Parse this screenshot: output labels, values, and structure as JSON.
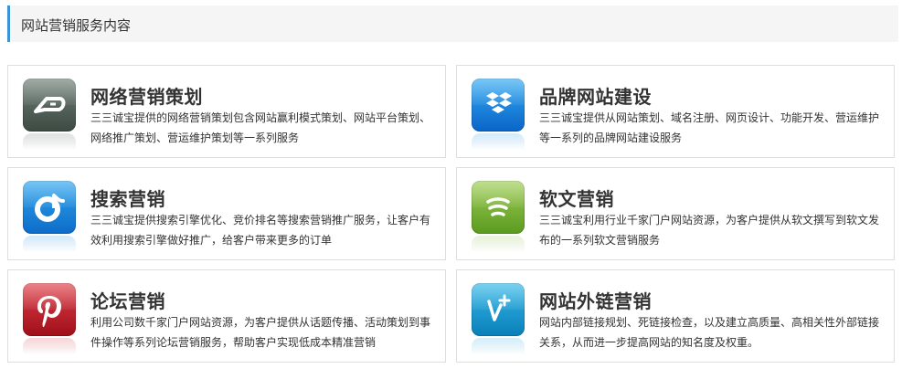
{
  "header": {
    "title": "网站营销服务内容"
  },
  "services": [
    {
      "title": "网络营销策划",
      "icon": "deviantart-icon",
      "color": "#4a5a52",
      "desc": "三三诚宝提供的网络营销策划包含网站赢利模式策划、网站平台策划、网络推广策划、营运维护策划等一系列服务"
    },
    {
      "title": "品牌网站建设",
      "icon": "dropbox-icon",
      "color": "#1a7ad8",
      "desc": "三三诚宝提供从网站策划、域名注册、网页设计、功能开发、营运维护等一系列的品牌网站建设服务"
    },
    {
      "title": "搜索营销",
      "icon": "rdio-icon",
      "color": "#1a86dc",
      "desc": "三三诚宝提供搜索引擎优化、竞价排名等搜索营销推广服务，让客户有效利用搜索引擎做好推广，给客户带来更多的订单"
    },
    {
      "title": "软文营销",
      "icon": "forrst-icon",
      "color": "#7ab43a",
      "desc": "三三诚宝利用行业千家门户网站资源，为客户提供从软文撰写到软文发布的一系列软文营销服务"
    },
    {
      "title": "论坛营销",
      "icon": "pinterest-icon",
      "color": "#c0202a",
      "desc": "利用公司数千家门户网站资源，为客户提供从话题传播、活动策划到事件操作等系列论坛营销服务，帮助客户实现低成本精准营销"
    },
    {
      "title": "网站外链营销",
      "icon": "vine-plus-icon",
      "color": "#1e9ad2",
      "desc": "网站内部链接规划、死链接检查，以及建立高质量、高相关性外部链接关系，从而进一步提高网站的知名度及权重。"
    }
  ]
}
